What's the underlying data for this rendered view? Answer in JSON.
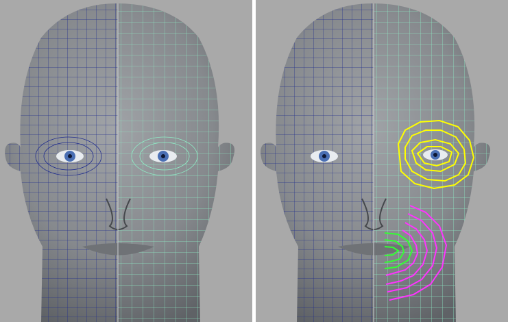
{
  "viewports": [
    {
      "id": "left",
      "view": "topology-comparison"
    },
    {
      "id": "right",
      "view": "edge-loops-highlighted"
    }
  ],
  "colors": {
    "background": "#a9a9a9",
    "skin": "#8b8e92",
    "wire_left": "#1d2a8c",
    "wire_right": "#8ff0c8",
    "eye_loop": "#ffff00",
    "mouth_inner_loop": "#33ff33",
    "mouth_outer_loop": "#ff33ff",
    "iris": "#4a6fb3"
  },
  "icons": [
    "head-mesh",
    "edge-loop"
  ]
}
